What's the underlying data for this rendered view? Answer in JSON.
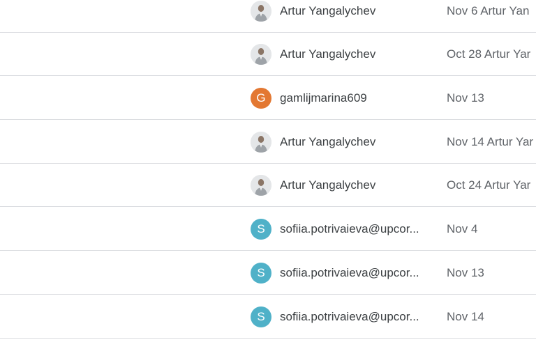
{
  "rows": [
    {
      "owner": "Artur Yangalychev",
      "avatar_type": "photo",
      "avatar_letter": "",
      "avatar_color": "",
      "modified": "Nov 6 Artur Yan"
    },
    {
      "owner": "Artur Yangalychev",
      "avatar_type": "photo",
      "avatar_letter": "",
      "avatar_color": "",
      "modified": "Oct 28 Artur Yar"
    },
    {
      "owner": "gamlijmarina609",
      "avatar_type": "letter",
      "avatar_letter": "G",
      "avatar_color": "#e37832",
      "modified": "Nov 13"
    },
    {
      "owner": "Artur Yangalychev",
      "avatar_type": "photo",
      "avatar_letter": "",
      "avatar_color": "",
      "modified": "Nov 14 Artur Yar"
    },
    {
      "owner": "Artur Yangalychev",
      "avatar_type": "photo",
      "avatar_letter": "",
      "avatar_color": "",
      "modified": "Oct 24 Artur Yar"
    },
    {
      "owner": "sofiia.potrivaieva@upcor...",
      "avatar_type": "letter",
      "avatar_letter": "S",
      "avatar_color": "#4fb1c8",
      "modified": "Nov 4"
    },
    {
      "owner": "sofiia.potrivaieva@upcor...",
      "avatar_type": "letter",
      "avatar_letter": "S",
      "avatar_color": "#4fb1c8",
      "modified": "Nov 13"
    },
    {
      "owner": "sofiia.potrivaieva@upcor...",
      "avatar_type": "letter",
      "avatar_letter": "S",
      "avatar_color": "#4fb1c8",
      "modified": "Nov 14"
    }
  ]
}
